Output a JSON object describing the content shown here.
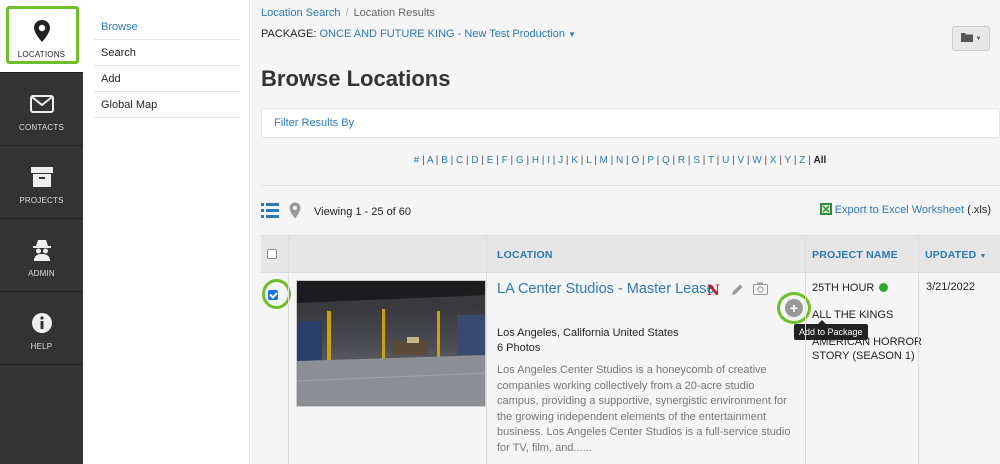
{
  "leftnav": {
    "items": [
      {
        "label": "LOCATIONS",
        "icon": "map-pin-icon"
      },
      {
        "label": "CONTACTS",
        "icon": "envelope-icon"
      },
      {
        "label": "PROJECTS",
        "icon": "archive-box-icon"
      },
      {
        "label": "ADMIN",
        "icon": "spy-icon"
      },
      {
        "label": "HELP",
        "icon": "info-icon"
      }
    ]
  },
  "subnav": {
    "items": [
      {
        "label": "Browse"
      },
      {
        "label": "Search"
      },
      {
        "label": "Add"
      },
      {
        "label": "Global Map"
      }
    ]
  },
  "breadcrumb": {
    "items": [
      "Location Search",
      "Location Results"
    ],
    "separator": "/"
  },
  "package": {
    "label": "PACKAGE:",
    "value": "ONCE AND FUTURE KING - New Test Production"
  },
  "page_title": "Browse Locations",
  "filter": {
    "label": "Filter Results By"
  },
  "alphabet": {
    "letters": [
      "#",
      "A",
      "B",
      "C",
      "D",
      "E",
      "F",
      "G",
      "H",
      "I",
      "J",
      "K",
      "L",
      "M",
      "N",
      "O",
      "P",
      "Q",
      "R",
      "S",
      "T",
      "U",
      "V",
      "W",
      "X",
      "Y",
      "Z"
    ],
    "all_label": "All"
  },
  "results": {
    "viewing": "Viewing 1 - 25 of 60",
    "export_label": "Export to Excel Worksheet",
    "export_ext": "(.xls)"
  },
  "table": {
    "columns": {
      "location": "LOCATION",
      "project_name": "PROJECT NAME",
      "updated": "UPDATED"
    },
    "rows": [
      {
        "name": "LA Center Studios - Master Lease",
        "badge": "N",
        "city": "Los Angeles, California United States",
        "photos": "6 Photos",
        "description": "Los Angeles Center Studios is a honeycomb of creative companies working collectively from a 20-acre studio campus, providing a supportive, synergistic environment for the growing independent elements of the entertainment business. Los Angeles Center Studios is a full-service studio for TV, film, and......",
        "tooltip": "Add to Package",
        "projects": [
          "25TH HOUR",
          "ALL THE KINGS",
          "AMERICAN HORROR STORY (SEASON 1)"
        ],
        "updated": "3/21/2022"
      }
    ]
  },
  "colors": {
    "link": "#2a7ab7",
    "nav_bg": "#333333",
    "highlight": "#6fbf2a",
    "status_green": "#2ea82e",
    "netflix_red": "#e50914"
  }
}
